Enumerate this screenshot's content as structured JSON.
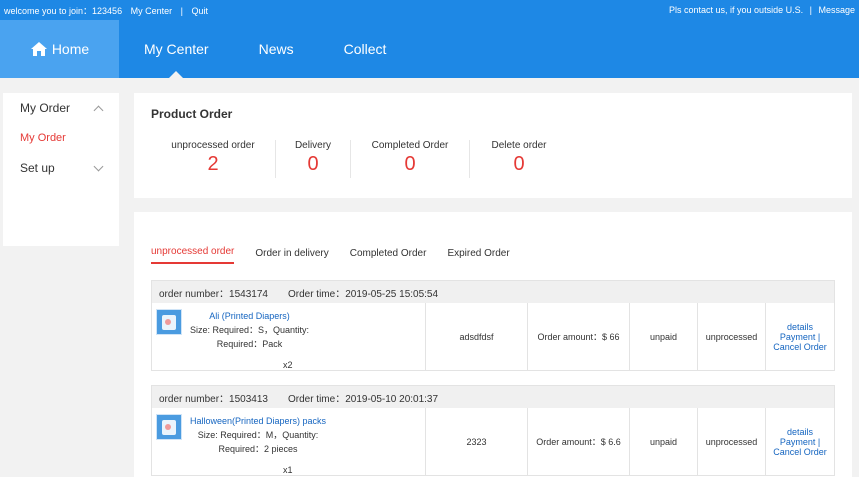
{
  "topbar": {
    "welcome": "welcome you to join：123456",
    "my_center": "My Center",
    "sep": "|",
    "quit": "Quit",
    "contact": "Pls contact us, if you outside U.S.",
    "sep2": "|",
    "message": "Message"
  },
  "nav": {
    "home": "Home",
    "items": [
      "My Center",
      "News",
      "Collect"
    ],
    "active_index": 0,
    "color": "#1e88e5",
    "home_bg": "#4aa3f0"
  },
  "sidebar": {
    "sections": [
      {
        "label": "My Order",
        "expanded": true,
        "children": [
          "My Order"
        ]
      },
      {
        "label": "Set up",
        "expanded": false,
        "children": []
      }
    ]
  },
  "product_order": {
    "title": "Product Order",
    "stats": [
      {
        "label": "unprocessed order",
        "value": "2"
      },
      {
        "label": "Delivery",
        "value": "0"
      },
      {
        "label": "Completed Order",
        "value": "0"
      },
      {
        "label": "Delete order",
        "value": "0"
      }
    ]
  },
  "orders_panel": {
    "tabs": [
      "unprocessed order",
      "Order in delivery",
      "Completed Order",
      "Expired Order"
    ],
    "active_tab": 0,
    "orders": [
      {
        "number": "order number：1543174",
        "time": "Order time：2019-05-25 15:05:54",
        "product_name": "Ali (Printed Diapers)",
        "size": "Size: Required：S，Quantity:",
        "required": "Required：Pack",
        "qty": "x2",
        "code": "adsdfdsf",
        "amount": "Order amount：$ 66",
        "payment_status": "unpaid",
        "order_status": "unprocessed",
        "actions": [
          "details",
          "Payment |",
          "Cancel Order"
        ]
      },
      {
        "number": "order number：1503413",
        "time": "Order time：2019-05-10 20:01:37",
        "product_name": "Halloween(Printed Diapers) packs",
        "size": "Size: Required：M，Quantity:",
        "required": "Required：2 pieces",
        "qty": "x1",
        "code": "2323",
        "amount": "Order amount：$ 6.6",
        "payment_status": "unpaid",
        "order_status": "unprocessed",
        "actions": [
          "details",
          "Payment |",
          "Cancel Order"
        ]
      }
    ]
  },
  "colors": {
    "accent": "#e53935",
    "link": "#1565c0"
  }
}
